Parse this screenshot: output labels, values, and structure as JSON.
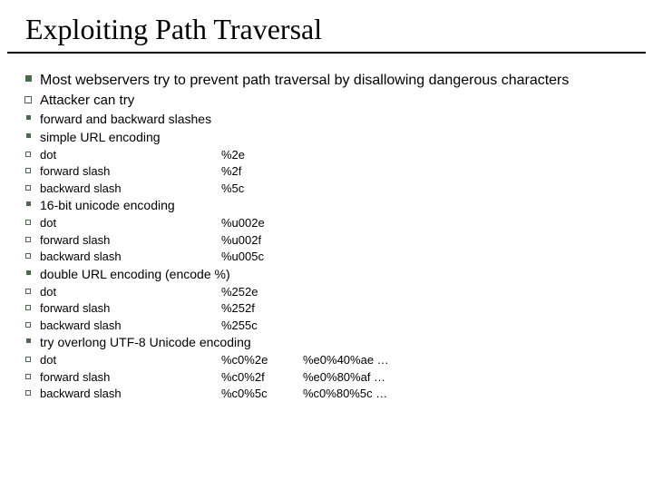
{
  "title": "Exploiting Path Traversal",
  "main": "Most webservers try to prevent path traversal by disallowing dangerous characters",
  "subhead": "Attacker can try",
  "methods": [
    {
      "label": "forward and backward slashes"
    },
    {
      "label": "simple URL encoding",
      "items": [
        {
          "name": "dot",
          "code": "%2e"
        },
        {
          "name": "forward slash",
          "code": "%2f"
        },
        {
          "name": "backward slash",
          "code": "%5c"
        }
      ]
    },
    {
      "label": "16-bit unicode encoding",
      "items": [
        {
          "name": "dot",
          "code": "%u002e"
        },
        {
          "name": "forward slash",
          "code": "%u002f"
        },
        {
          "name": "backward slash",
          "code": "%u005c"
        }
      ]
    },
    {
      "label": "double URL encoding (encode %)",
      "items": [
        {
          "name": "dot",
          "code": "%252e"
        },
        {
          "name": "forward slash",
          "code": "%252f"
        },
        {
          "name": "backward slash",
          "code": "%255c"
        }
      ]
    },
    {
      "label": "try overlong UTF-8 Unicode encoding",
      "items": [
        {
          "name": "dot",
          "code": "%c0%2e",
          "alt": "%e0%40%ae …"
        },
        {
          "name": "forward slash",
          "code": "%c0%2f",
          "alt": "%e0%80%af …"
        },
        {
          "name": "backward slash",
          "code": "%c0%5c",
          "alt": "%c0%80%5c …"
        }
      ]
    }
  ]
}
